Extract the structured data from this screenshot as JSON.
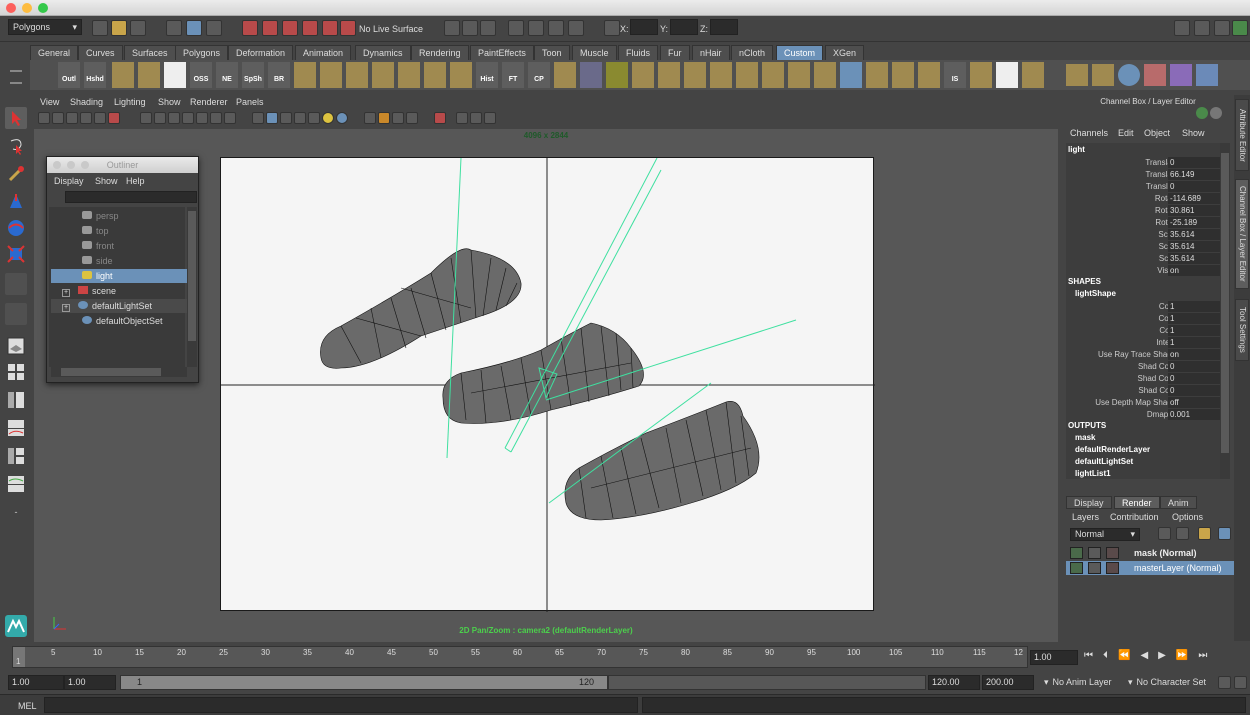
{
  "statusline": {
    "menuset": "Polygons",
    "live_surface": "No Live Surface",
    "x_label": "X:",
    "y_label": "Y:",
    "z_label": "Z:"
  },
  "shelf_tabs": [
    "General",
    "Curves",
    "Surfaces",
    "Polygons",
    "Deformation",
    "Animation",
    "Dynamics",
    "Rendering",
    "PaintEffects",
    "Toon",
    "Muscle",
    "Fluids",
    "Fur",
    "nHair",
    "nCloth",
    "Custom",
    "XGen"
  ],
  "shelf_active": "Custom",
  "shelf_buttons": [
    "Outl",
    "Hshd",
    "OSS",
    "NE",
    "SpSh",
    "BR",
    "Hist",
    "FT",
    "CP",
    "IS"
  ],
  "viewport": {
    "menus": [
      "View",
      "Shading",
      "Lighting",
      "Show",
      "Renderer",
      "Panels"
    ],
    "resolution": "4096 x 2844",
    "camera_label": "2D Pan/Zoom : camera2 (defaultRenderLayer)"
  },
  "outliner": {
    "title": "Outliner",
    "menus": [
      "Display",
      "Show",
      "Help"
    ],
    "items": [
      {
        "label": "persp",
        "state": "dim"
      },
      {
        "label": "top",
        "state": "dim"
      },
      {
        "label": "front",
        "state": "dim"
      },
      {
        "label": "side",
        "state": "dim"
      },
      {
        "label": "light",
        "state": "selected"
      },
      {
        "label": "scene",
        "state": "normal"
      },
      {
        "label": "defaultLightSet",
        "state": "normal"
      },
      {
        "label": "defaultObjectSet",
        "state": "normal"
      }
    ]
  },
  "channel_box": {
    "title": "Channel Box / Layer Editor",
    "menus": [
      "Channels",
      "Edit",
      "Object",
      "Show"
    ],
    "object": "light",
    "attributes": [
      {
        "name": "Translate X",
        "value": "0"
      },
      {
        "name": "Translate Y",
        "value": "66.149"
      },
      {
        "name": "Translate Z",
        "value": "0"
      },
      {
        "name": "Rotate X",
        "value": "-114.689"
      },
      {
        "name": "Rotate Y",
        "value": "30.861"
      },
      {
        "name": "Rotate Z",
        "value": "-25.189"
      },
      {
        "name": "Scale X",
        "value": "35.614"
      },
      {
        "name": "Scale Y",
        "value": "35.614"
      },
      {
        "name": "Scale Z",
        "value": "35.614"
      },
      {
        "name": "Visibility",
        "value": "on"
      }
    ],
    "shapes_header": "SHAPES",
    "shape_name": "lightShape",
    "shape_attributes": [
      {
        "name": "Color R",
        "value": "1"
      },
      {
        "name": "Color G",
        "value": "1"
      },
      {
        "name": "Color B",
        "value": "1"
      },
      {
        "name": "Intensity",
        "value": "1"
      },
      {
        "name": "Use Ray Trace Shadows",
        "value": "on"
      },
      {
        "name": "Shad Color R",
        "value": "0"
      },
      {
        "name": "Shad Color G",
        "value": "0"
      },
      {
        "name": "Shad Color B",
        "value": "0"
      },
      {
        "name": "Use Depth Map Shadows",
        "value": "off"
      },
      {
        "name": "Dmap Bias",
        "value": "0.001"
      }
    ],
    "outputs_header": "OUTPUTS",
    "outputs": [
      "mask",
      "defaultRenderLayer",
      "defaultLightSet",
      "lightList1"
    ]
  },
  "layer_editor": {
    "tabs": [
      "Display",
      "Render",
      "Anim"
    ],
    "active_tab": "Render",
    "menus": [
      "Layers",
      "Contribution",
      "Options"
    ],
    "blend_mode": "Normal",
    "layers": [
      {
        "label": "mask (Normal)",
        "selected": false
      },
      {
        "label": "masterLayer (Normal)",
        "selected": true
      }
    ]
  },
  "side_tabs": [
    "Attribute Editor",
    "Channel Box / Layer Editor",
    "Tool Settings"
  ],
  "time_slider": {
    "ticks": [
      "5",
      "10",
      "15",
      "20",
      "25",
      "30",
      "35",
      "40",
      "45",
      "50",
      "55",
      "60",
      "65",
      "70",
      "75",
      "80",
      "85",
      "90",
      "95",
      "100",
      "105",
      "110",
      "115",
      "12"
    ],
    "first_frame": "1",
    "current_time": "1.00"
  },
  "range_slider": {
    "start": "1.00",
    "playback_start": "1.00",
    "range_left": "1",
    "range_right": "120",
    "playback_end": "120.00",
    "end": "200.00",
    "anim_layer": "No Anim Layer",
    "character_set": "No Character Set"
  },
  "command_line": {
    "label": "MEL"
  },
  "colors": {
    "accent": "#6b91b8",
    "light_wire": "#3fe0a0",
    "mesh_fill": "#6a6a6a"
  }
}
